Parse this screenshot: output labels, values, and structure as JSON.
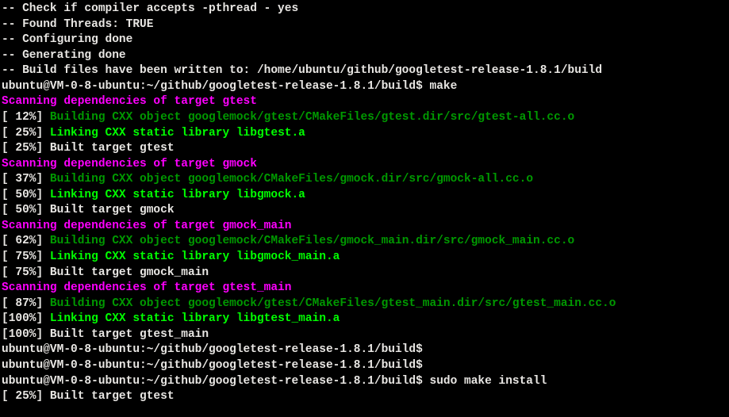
{
  "lines": [
    {
      "segments": [
        {
          "cls": "white",
          "text": "-- Check if compiler accepts -pthread - yes"
        }
      ]
    },
    {
      "segments": [
        {
          "cls": "white",
          "text": "-- Found Threads: TRUE"
        }
      ]
    },
    {
      "segments": [
        {
          "cls": "white",
          "text": "-- Configuring done"
        }
      ]
    },
    {
      "segments": [
        {
          "cls": "white",
          "text": "-- Generating done"
        }
      ]
    },
    {
      "segments": [
        {
          "cls": "white",
          "text": "-- Build files have been written to: /home/ubuntu/github/googletest-release-1.8.1/build"
        }
      ]
    },
    {
      "segments": [
        {
          "cls": "white",
          "text": "ubuntu@VM-0-8-ubuntu:~/github/googletest-release-1.8.1/build$ make"
        }
      ]
    },
    {
      "segments": [
        {
          "cls": "magenta bold",
          "text": "Scanning dependencies of target gtest"
        }
      ]
    },
    {
      "segments": [
        {
          "cls": "white",
          "text": "[ 12%] "
        },
        {
          "cls": "dim-green",
          "text": "Building CXX object googlemock/gtest/CMakeFiles/gtest.dir/src/gtest-all.cc.o"
        }
      ]
    },
    {
      "segments": [
        {
          "cls": "white",
          "text": "[ 25%] "
        },
        {
          "cls": "green bold",
          "text": "Linking CXX static library libgtest.a"
        }
      ]
    },
    {
      "segments": [
        {
          "cls": "white",
          "text": "[ 25%] Built target gtest"
        }
      ]
    },
    {
      "segments": [
        {
          "cls": "magenta bold",
          "text": "Scanning dependencies of target gmock"
        }
      ]
    },
    {
      "segments": [
        {
          "cls": "white",
          "text": "[ 37%] "
        },
        {
          "cls": "dim-green",
          "text": "Building CXX object googlemock/CMakeFiles/gmock.dir/src/gmock-all.cc.o"
        }
      ]
    },
    {
      "segments": [
        {
          "cls": "white",
          "text": "[ 50%] "
        },
        {
          "cls": "green bold",
          "text": "Linking CXX static library libgmock.a"
        }
      ]
    },
    {
      "segments": [
        {
          "cls": "white",
          "text": "[ 50%] Built target gmock"
        }
      ]
    },
    {
      "segments": [
        {
          "cls": "magenta bold",
          "text": "Scanning dependencies of target gmock_main"
        }
      ]
    },
    {
      "segments": [
        {
          "cls": "white",
          "text": "[ 62%] "
        },
        {
          "cls": "dim-green",
          "text": "Building CXX object googlemock/CMakeFiles/gmock_main.dir/src/gmock_main.cc.o"
        }
      ]
    },
    {
      "segments": [
        {
          "cls": "white",
          "text": "[ 75%] "
        },
        {
          "cls": "green bold",
          "text": "Linking CXX static library libgmock_main.a"
        }
      ]
    },
    {
      "segments": [
        {
          "cls": "white",
          "text": "[ 75%] Built target gmock_main"
        }
      ]
    },
    {
      "segments": [
        {
          "cls": "magenta bold",
          "text": "Scanning dependencies of target gtest_main"
        }
      ]
    },
    {
      "segments": [
        {
          "cls": "white",
          "text": "[ 87%] "
        },
        {
          "cls": "dim-green",
          "text": "Building CXX object googlemock/gtest/CMakeFiles/gtest_main.dir/src/gtest_main.cc.o"
        }
      ]
    },
    {
      "segments": [
        {
          "cls": "white",
          "text": "[100%] "
        },
        {
          "cls": "green bold",
          "text": "Linking CXX static library libgtest_main.a"
        }
      ]
    },
    {
      "segments": [
        {
          "cls": "white",
          "text": "[100%] Built target gtest_main"
        }
      ]
    },
    {
      "segments": [
        {
          "cls": "white",
          "text": "ubuntu@VM-0-8-ubuntu:~/github/googletest-release-1.8.1/build$"
        }
      ]
    },
    {
      "segments": [
        {
          "cls": "white",
          "text": "ubuntu@VM-0-8-ubuntu:~/github/googletest-release-1.8.1/build$"
        }
      ]
    },
    {
      "segments": [
        {
          "cls": "white",
          "text": "ubuntu@VM-0-8-ubuntu:~/github/googletest-release-1.8.1/build$ sudo make install"
        }
      ]
    },
    {
      "segments": [
        {
          "cls": "white",
          "text": "[ 25%] Built target gtest"
        }
      ]
    }
  ]
}
